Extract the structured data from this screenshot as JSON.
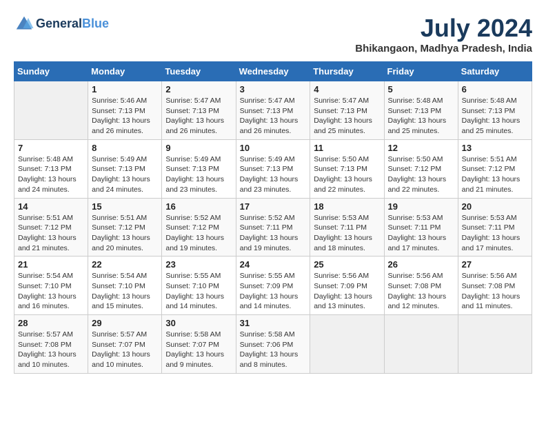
{
  "header": {
    "logo_line1": "General",
    "logo_line2": "Blue",
    "month_year": "July 2024",
    "location": "Bhikangaon, Madhya Pradesh, India"
  },
  "weekdays": [
    "Sunday",
    "Monday",
    "Tuesday",
    "Wednesday",
    "Thursday",
    "Friday",
    "Saturday"
  ],
  "weeks": [
    [
      {
        "day": "",
        "sunrise": "",
        "sunset": "",
        "daylight": ""
      },
      {
        "day": "1",
        "sunrise": "Sunrise: 5:46 AM",
        "sunset": "Sunset: 7:13 PM",
        "daylight": "Daylight: 13 hours and 26 minutes."
      },
      {
        "day": "2",
        "sunrise": "Sunrise: 5:47 AM",
        "sunset": "Sunset: 7:13 PM",
        "daylight": "Daylight: 13 hours and 26 minutes."
      },
      {
        "day": "3",
        "sunrise": "Sunrise: 5:47 AM",
        "sunset": "Sunset: 7:13 PM",
        "daylight": "Daylight: 13 hours and 26 minutes."
      },
      {
        "day": "4",
        "sunrise": "Sunrise: 5:47 AM",
        "sunset": "Sunset: 7:13 PM",
        "daylight": "Daylight: 13 hours and 25 minutes."
      },
      {
        "day": "5",
        "sunrise": "Sunrise: 5:48 AM",
        "sunset": "Sunset: 7:13 PM",
        "daylight": "Daylight: 13 hours and 25 minutes."
      },
      {
        "day": "6",
        "sunrise": "Sunrise: 5:48 AM",
        "sunset": "Sunset: 7:13 PM",
        "daylight": "Daylight: 13 hours and 25 minutes."
      }
    ],
    [
      {
        "day": "7",
        "sunrise": "Sunrise: 5:48 AM",
        "sunset": "Sunset: 7:13 PM",
        "daylight": "Daylight: 13 hours and 24 minutes."
      },
      {
        "day": "8",
        "sunrise": "Sunrise: 5:49 AM",
        "sunset": "Sunset: 7:13 PM",
        "daylight": "Daylight: 13 hours and 24 minutes."
      },
      {
        "day": "9",
        "sunrise": "Sunrise: 5:49 AM",
        "sunset": "Sunset: 7:13 PM",
        "daylight": "Daylight: 13 hours and 23 minutes."
      },
      {
        "day": "10",
        "sunrise": "Sunrise: 5:49 AM",
        "sunset": "Sunset: 7:13 PM",
        "daylight": "Daylight: 13 hours and 23 minutes."
      },
      {
        "day": "11",
        "sunrise": "Sunrise: 5:50 AM",
        "sunset": "Sunset: 7:13 PM",
        "daylight": "Daylight: 13 hours and 22 minutes."
      },
      {
        "day": "12",
        "sunrise": "Sunrise: 5:50 AM",
        "sunset": "Sunset: 7:12 PM",
        "daylight": "Daylight: 13 hours and 22 minutes."
      },
      {
        "day": "13",
        "sunrise": "Sunrise: 5:51 AM",
        "sunset": "Sunset: 7:12 PM",
        "daylight": "Daylight: 13 hours and 21 minutes."
      }
    ],
    [
      {
        "day": "14",
        "sunrise": "Sunrise: 5:51 AM",
        "sunset": "Sunset: 7:12 PM",
        "daylight": "Daylight: 13 hours and 21 minutes."
      },
      {
        "day": "15",
        "sunrise": "Sunrise: 5:51 AM",
        "sunset": "Sunset: 7:12 PM",
        "daylight": "Daylight: 13 hours and 20 minutes."
      },
      {
        "day": "16",
        "sunrise": "Sunrise: 5:52 AM",
        "sunset": "Sunset: 7:12 PM",
        "daylight": "Daylight: 13 hours and 19 minutes."
      },
      {
        "day": "17",
        "sunrise": "Sunrise: 5:52 AM",
        "sunset": "Sunset: 7:11 PM",
        "daylight": "Daylight: 13 hours and 19 minutes."
      },
      {
        "day": "18",
        "sunrise": "Sunrise: 5:53 AM",
        "sunset": "Sunset: 7:11 PM",
        "daylight": "Daylight: 13 hours and 18 minutes."
      },
      {
        "day": "19",
        "sunrise": "Sunrise: 5:53 AM",
        "sunset": "Sunset: 7:11 PM",
        "daylight": "Daylight: 13 hours and 17 minutes."
      },
      {
        "day": "20",
        "sunrise": "Sunrise: 5:53 AM",
        "sunset": "Sunset: 7:11 PM",
        "daylight": "Daylight: 13 hours and 17 minutes."
      }
    ],
    [
      {
        "day": "21",
        "sunrise": "Sunrise: 5:54 AM",
        "sunset": "Sunset: 7:10 PM",
        "daylight": "Daylight: 13 hours and 16 minutes."
      },
      {
        "day": "22",
        "sunrise": "Sunrise: 5:54 AM",
        "sunset": "Sunset: 7:10 PM",
        "daylight": "Daylight: 13 hours and 15 minutes."
      },
      {
        "day": "23",
        "sunrise": "Sunrise: 5:55 AM",
        "sunset": "Sunset: 7:10 PM",
        "daylight": "Daylight: 13 hours and 14 minutes."
      },
      {
        "day": "24",
        "sunrise": "Sunrise: 5:55 AM",
        "sunset": "Sunset: 7:09 PM",
        "daylight": "Daylight: 13 hours and 14 minutes."
      },
      {
        "day": "25",
        "sunrise": "Sunrise: 5:56 AM",
        "sunset": "Sunset: 7:09 PM",
        "daylight": "Daylight: 13 hours and 13 minutes."
      },
      {
        "day": "26",
        "sunrise": "Sunrise: 5:56 AM",
        "sunset": "Sunset: 7:08 PM",
        "daylight": "Daylight: 13 hours and 12 minutes."
      },
      {
        "day": "27",
        "sunrise": "Sunrise: 5:56 AM",
        "sunset": "Sunset: 7:08 PM",
        "daylight": "Daylight: 13 hours and 11 minutes."
      }
    ],
    [
      {
        "day": "28",
        "sunrise": "Sunrise: 5:57 AM",
        "sunset": "Sunset: 7:08 PM",
        "daylight": "Daylight: 13 hours and 10 minutes."
      },
      {
        "day": "29",
        "sunrise": "Sunrise: 5:57 AM",
        "sunset": "Sunset: 7:07 PM",
        "daylight": "Daylight: 13 hours and 10 minutes."
      },
      {
        "day": "30",
        "sunrise": "Sunrise: 5:58 AM",
        "sunset": "Sunset: 7:07 PM",
        "daylight": "Daylight: 13 hours and 9 minutes."
      },
      {
        "day": "31",
        "sunrise": "Sunrise: 5:58 AM",
        "sunset": "Sunset: 7:06 PM",
        "daylight": "Daylight: 13 hours and 8 minutes."
      },
      {
        "day": "",
        "sunrise": "",
        "sunset": "",
        "daylight": ""
      },
      {
        "day": "",
        "sunrise": "",
        "sunset": "",
        "daylight": ""
      },
      {
        "day": "",
        "sunrise": "",
        "sunset": "",
        "daylight": ""
      }
    ]
  ]
}
